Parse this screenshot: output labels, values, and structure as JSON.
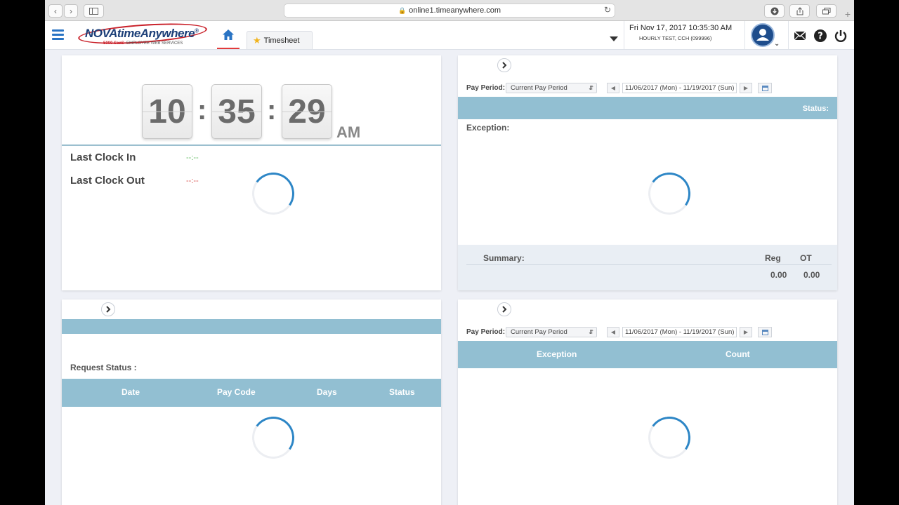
{
  "browser": {
    "url": "online1.timeanywhere.com"
  },
  "header": {
    "brand": "NOVAtimeAnywhere",
    "brand_reg": "®",
    "brand_sub_strong": "5000 SaaS",
    "brand_sub": "EMPLOYEE WEB SERVICES",
    "tab_label": "Timesheet",
    "datetime": "Fri Nov 17, 2017 10:35:30 AM",
    "user": "HOURLY TEST, CCH (099996)"
  },
  "clock": {
    "hours": "10",
    "minutes": "35",
    "seconds": "29",
    "sep": ":",
    "ampm": "AM",
    "last_in_label": "Last Clock In",
    "last_in_value": "--:--",
    "last_out_label": "Last Clock Out",
    "last_out_value": "--:--"
  },
  "exceptions_panel": {
    "pay_period_label": "Pay Period:",
    "pay_period_value": "Current Pay Period",
    "range": "11/06/2017 (Mon) - 11/19/2017 (Sun)",
    "status_label": "Status:",
    "exception_label": "Exception:",
    "summary_label": "Summary:",
    "reg_label": "Reg",
    "ot_label": "OT",
    "reg_value": "0.00",
    "ot_value": "0.00"
  },
  "request_panel": {
    "request_status_label": "Request Status :",
    "columns": [
      "Date",
      "Pay Code",
      "Days",
      "Status"
    ]
  },
  "exception_count_panel": {
    "pay_period_label": "Pay Period:",
    "pay_period_value": "Current Pay Period",
    "range": "11/06/2017 (Mon) - 11/19/2017 (Sun)",
    "columns": [
      "Exception",
      "Count"
    ]
  },
  "colors": {
    "band": "#92bfd2",
    "accent": "#2a74c4",
    "spinner": "#2d86c6",
    "clock_in": "#5cb85c",
    "clock_out": "#d9534f"
  }
}
